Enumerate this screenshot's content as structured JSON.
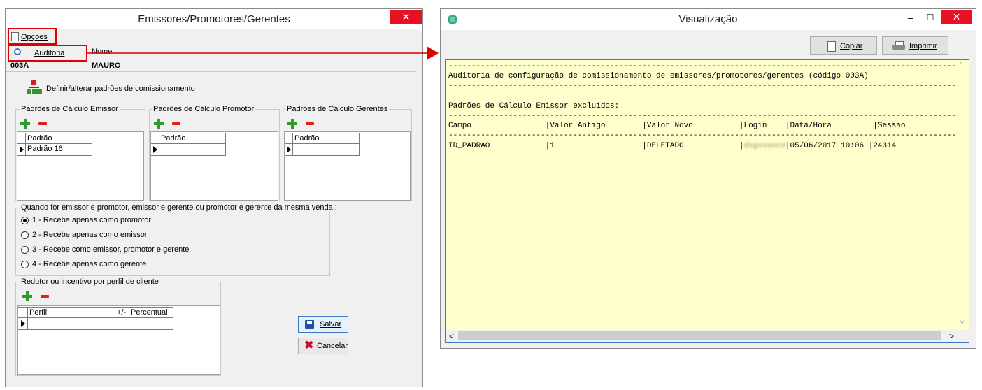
{
  "left_window": {
    "title": "Emissores/Promotores/Gerentes",
    "close": "✕",
    "menu": {
      "opcoes": "Opções",
      "auditoria": "Auditoria"
    },
    "header": {
      "name_label": "Nome",
      "code_value": "003A",
      "name_value": "MAURO"
    },
    "define_link": "Definir/alterar padrões de comissionamento",
    "groups": [
      {
        "title": "Padrões de Cálculo Emissor",
        "column": "Padrão",
        "row_value": "Padrão 16"
      },
      {
        "title": "Padrões de Cálculo  Promotor",
        "column": "Padrão",
        "row_value": ""
      },
      {
        "title": "Padrões de Cálculo Gerentes",
        "column": "Padrão",
        "row_value": ""
      }
    ],
    "radio_group": {
      "title": "Quando for emissor e promotor, emissor e gerente ou promotor e gerente da mesma venda :",
      "options": [
        "1 - Recebe apenas como promotor",
        "2 - Recebe apenas como emissor",
        "3 - Recebe como emissor, promotor e gerente",
        "4 - Recebe apenas como gerente"
      ],
      "selected_index": 0
    },
    "redutor": {
      "title": "Redutor ou incentivo por perfil de cliente",
      "columns": [
        "Perfil",
        "+/-",
        "Percentual"
      ]
    },
    "buttons": {
      "salvar": "Salvar",
      "cancelar": "Cancelar"
    }
  },
  "right_window": {
    "title": "Visualização",
    "minimize": "–",
    "maximize": "☐",
    "close": "✕",
    "buttons": {
      "copiar": "Copiar",
      "imprimir": "Imprimir"
    },
    "report": {
      "rule": "---------------------------------------------------------------------------------------------------------------------",
      "heading": "Auditoria de configuração de comissionamento de emissores/promotores/gerentes (código 003A)",
      "section": "Padrões de Cálculo Emissor excluídos:",
      "columns_line": "Campo                |Valor Antigo        |Valor Novo          |Login    |Data/Hora         |Sessão",
      "row_part1": "ID_PADRAO            |1                   |DELETADO            |",
      "row_login": "dsgvsavcn",
      "row_part2": "|05/06/2017 10:06 |24314"
    },
    "scroll": {
      "left": "<",
      "right": ">",
      "up": "^",
      "down": "v"
    }
  },
  "colors": {
    "highlight_red": "#e00000",
    "report_bg": "#ffffcc",
    "close_red": "#e81123"
  }
}
